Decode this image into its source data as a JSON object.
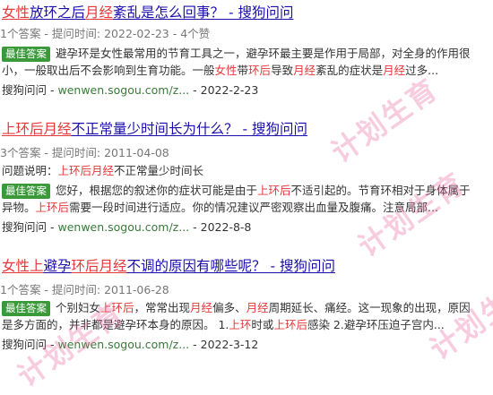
{
  "results": [
    {
      "title_parts": [
        {
          "text": "女性",
          "hl": true
        },
        {
          "text": "放环之后",
          "hl": false
        },
        {
          "text": "月经",
          "hl": true
        },
        {
          "text": "紊乱是怎么回事？ - 搜狗问问",
          "hl": false
        }
      ],
      "meta": "1个答案 - 提问时间: 2022-02-23 - 4个赞",
      "question_desc": "",
      "best_label": "最佳答案",
      "snippet_line1_parts": [
        {
          "text": "避孕环是女性最常用的节育工具之一，避孕环最主要是作用于局部，对全身的作用很",
          "hl": false
        }
      ],
      "snippet_line2_parts": [
        {
          "text": "小，一般取出后不会影响到生育功能。一般",
          "hl": false
        },
        {
          "text": "女性",
          "hl": true
        },
        {
          "text": "带",
          "hl": false
        },
        {
          "text": "环后",
          "hl": true
        },
        {
          "text": "导致",
          "hl": false
        },
        {
          "text": "月经",
          "hl": true
        },
        {
          "text": "紊乱的症状是",
          "hl": false
        },
        {
          "text": "月经",
          "hl": true
        },
        {
          "text": "过多...",
          "hl": false
        }
      ],
      "source_name": "搜狗问问",
      "source_url": "wenwen.sogou.com/z...",
      "date": "2022-2-23"
    },
    {
      "title_parts": [
        {
          "text": "上环后月经",
          "hl": true
        },
        {
          "text": "不正常量少时间长为什么？ - 搜狗问问",
          "hl": false
        }
      ],
      "meta": "3个答案 - 提问时间: 2011-04-08",
      "question_desc_label": "问题说明：",
      "question_desc_parts": [
        {
          "text": "上环后月经",
          "hl": true
        },
        {
          "text": "不正常量少时间长",
          "hl": false
        }
      ],
      "best_label": "最佳答案",
      "snippet_line1_parts": [
        {
          "text": "您好，根据您的叙述你的症状可能是由于",
          "hl": false
        },
        {
          "text": "上环后",
          "hl": true
        },
        {
          "text": "不适引起的。节育环相对于身体属于",
          "hl": false
        }
      ],
      "snippet_line2_parts": [
        {
          "text": "异物。",
          "hl": false
        },
        {
          "text": "上环后",
          "hl": true
        },
        {
          "text": "需要一段时间进行适应。你的情况建议严密观察出血量及腹痛。注意局部...",
          "hl": false
        }
      ],
      "source_name": "搜狗问问",
      "source_url": "wenwen.sogou.com/z...",
      "date": "2022-8-8"
    },
    {
      "title_parts": [
        {
          "text": "女性上",
          "hl": true
        },
        {
          "text": "避孕",
          "hl": false
        },
        {
          "text": "环后月经",
          "hl": true
        },
        {
          "text": "不调的原因有哪些呢？ - 搜狗问问",
          "hl": false
        }
      ],
      "meta": "1个答案 - 提问时间: 2011-06-28",
      "question_desc": "",
      "best_label": "最佳答案",
      "snippet_line1_parts": [
        {
          "text": "个别妇女",
          "hl": false
        },
        {
          "text": "上环后",
          "hl": true
        },
        {
          "text": "，常常出现",
          "hl": false
        },
        {
          "text": "月经",
          "hl": true
        },
        {
          "text": "偏多、",
          "hl": false
        },
        {
          "text": "月经",
          "hl": true
        },
        {
          "text": "周期延长、痛经。这一现象的出现，原因",
          "hl": false
        }
      ],
      "snippet_line2_parts": [
        {
          "text": "是多方面的，并非都是避孕环本身的原因。 1.",
          "hl": false
        },
        {
          "text": "上环",
          "hl": true
        },
        {
          "text": "时或",
          "hl": false
        },
        {
          "text": "上环后",
          "hl": true
        },
        {
          "text": "感染 2.避孕环压迫子宫内...",
          "hl": false
        }
      ],
      "source_name": "搜狗问问",
      "source_url": "wenwen.sogou.com/z...",
      "date": "2022-3-12"
    }
  ],
  "colors": {
    "link": "#1a0dab",
    "highlight": "#e5383b",
    "best_badge": "#3a9a3a",
    "url": "#3a7a3a",
    "watermark": "#e96ea0"
  },
  "watermark": {
    "text": "计划生育"
  }
}
